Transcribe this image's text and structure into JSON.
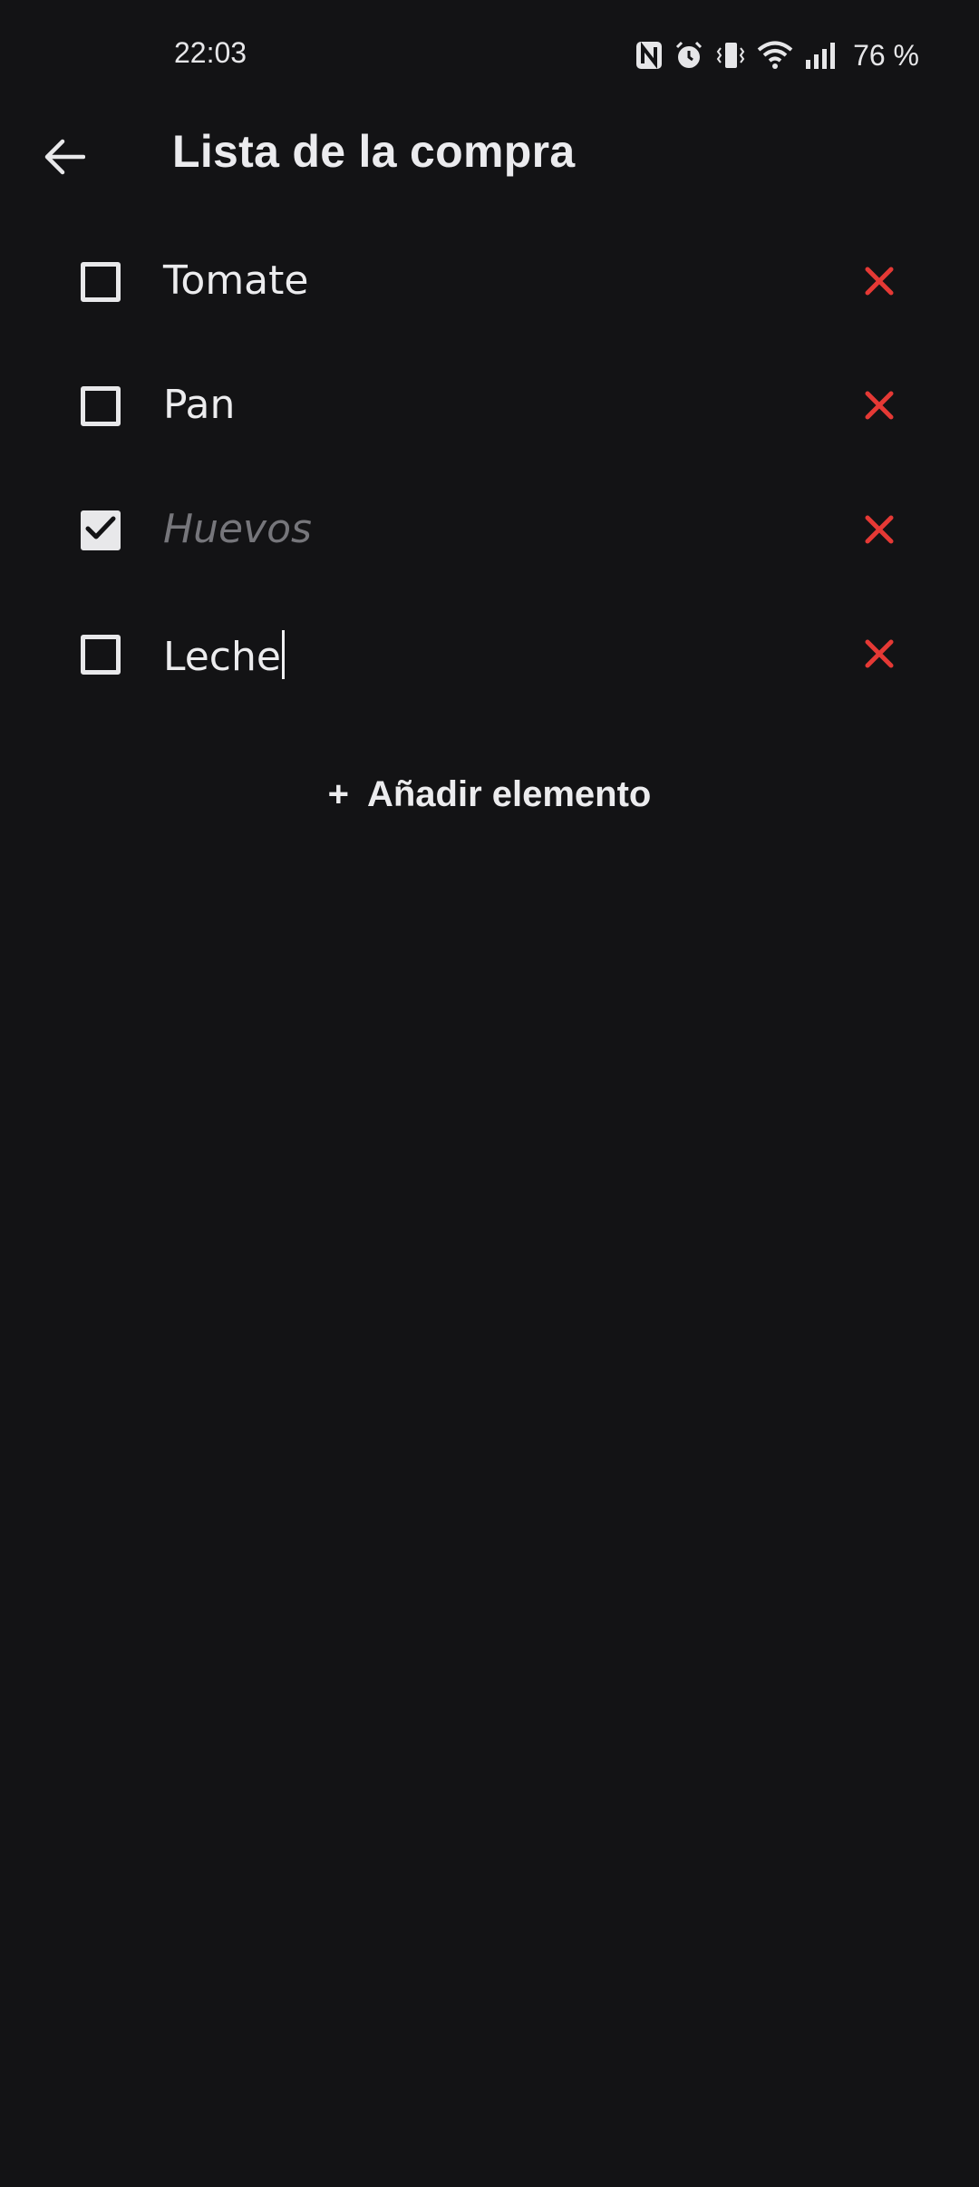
{
  "status_bar": {
    "time": "22:03",
    "battery": "76 %",
    "icons": [
      "nfc-icon",
      "alarm-icon",
      "vibrate-icon",
      "wifi-icon",
      "signal-icon"
    ]
  },
  "app_bar": {
    "title": "Lista de la compra",
    "back_icon": "arrow-back-icon"
  },
  "items": [
    {
      "label": "Tomate",
      "checked": false
    },
    {
      "label": "Pan",
      "checked": false
    },
    {
      "label": "Huevos",
      "checked": true
    },
    {
      "label": "Leche",
      "checked": false,
      "editing": true
    }
  ],
  "add_item": {
    "icon": "+",
    "label": "Añadir elemento"
  },
  "colors": {
    "background": "#131315",
    "text": "#ececee",
    "done_text": "#76767b",
    "delete": "#e53935"
  }
}
